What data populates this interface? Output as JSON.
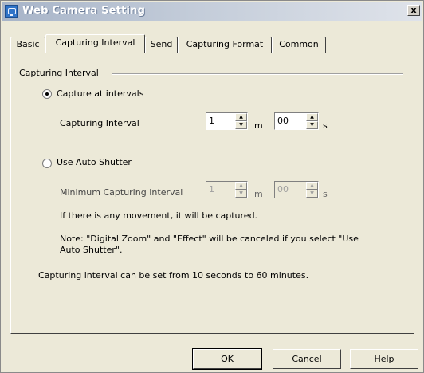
{
  "window": {
    "title": "Web Camera Setting",
    "close_label": "x"
  },
  "tabs": [
    {
      "label": "Basic"
    },
    {
      "label": "Capturing Interval"
    },
    {
      "label": "Send"
    },
    {
      "label": "Capturing Format"
    },
    {
      "label": "Common"
    }
  ],
  "active_tab": "Capturing Interval",
  "group": {
    "label": "Capturing Interval"
  },
  "option_intervals": {
    "label": "Capture at intervals",
    "selected": true,
    "field_label": "Capturing Interval",
    "minutes": "1",
    "minutes_unit": "m",
    "seconds": "00",
    "seconds_unit": "s"
  },
  "option_auto": {
    "label": "Use Auto Shutter",
    "selected": false,
    "field_label": "Minimum Capturing Interval",
    "minutes": "1",
    "minutes_unit": "m",
    "seconds": "00",
    "seconds_unit": "s",
    "info": "If there is any movement, it will be captured.",
    "note_line1": "Note: \"Digital Zoom\" and \"Effect\" will be canceled if you select \"Use",
    "note_line2": "Auto Shutter\"."
  },
  "range_note": "Capturing interval can be set from 10 seconds to 60 minutes.",
  "buttons": {
    "ok": "OK",
    "cancel": "Cancel",
    "help": "Help"
  }
}
